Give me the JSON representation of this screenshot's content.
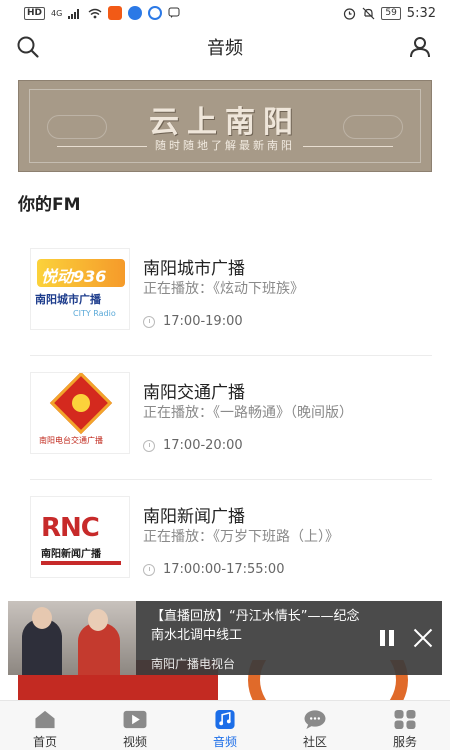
{
  "status_bar": {
    "left_badges": [
      "HD",
      "4G"
    ],
    "battery": "59",
    "time": "5:32"
  },
  "header": {
    "title": "音频",
    "search_icon": "search-icon",
    "user_icon": "user-icon"
  },
  "banner": {
    "title": "云上南阳",
    "subtitle": "随时随地了解最新南阳"
  },
  "section": {
    "title": "你的FM"
  },
  "fm_list": [
    {
      "name": "南阳城市广播",
      "now_playing": "正在播放：《炫动下班族》",
      "time": "17:00-19:00",
      "logo": {
        "top_text": "悦动936",
        "name_text": "南阳城市广播",
        "sub_text": "CITY Radio"
      }
    },
    {
      "name": "南阳交通广播",
      "now_playing": "正在播放：《一路畅通》（晚间版）",
      "time": "17:00-20:00",
      "logo": {
        "name_text": "南阳电台交通广播"
      }
    },
    {
      "name": "南阳新闻广播",
      "now_playing": "正在播放：《万岁下班路（上）》",
      "time": "17:00:00-17:55:00",
      "logo": {
        "top_text": "RNC",
        "name_text": "南阳新闻广播"
      }
    }
  ],
  "player": {
    "title": "【直播回放】“丹江水情长”——纪念南水北调中线工",
    "subtitle": "南阳广播电视台"
  },
  "tabs": [
    {
      "label": "首页",
      "icon": "home-icon",
      "active": false
    },
    {
      "label": "视频",
      "icon": "video-icon",
      "active": false
    },
    {
      "label": "音频",
      "icon": "music-icon",
      "active": true
    },
    {
      "label": "社区",
      "icon": "chat-icon",
      "active": false
    },
    {
      "label": "服务",
      "icon": "grid-icon",
      "active": false
    }
  ],
  "colors": {
    "accent": "#1c6ee8",
    "banner_bg": "#a79a88",
    "player_bg": "#3c3c3c"
  }
}
